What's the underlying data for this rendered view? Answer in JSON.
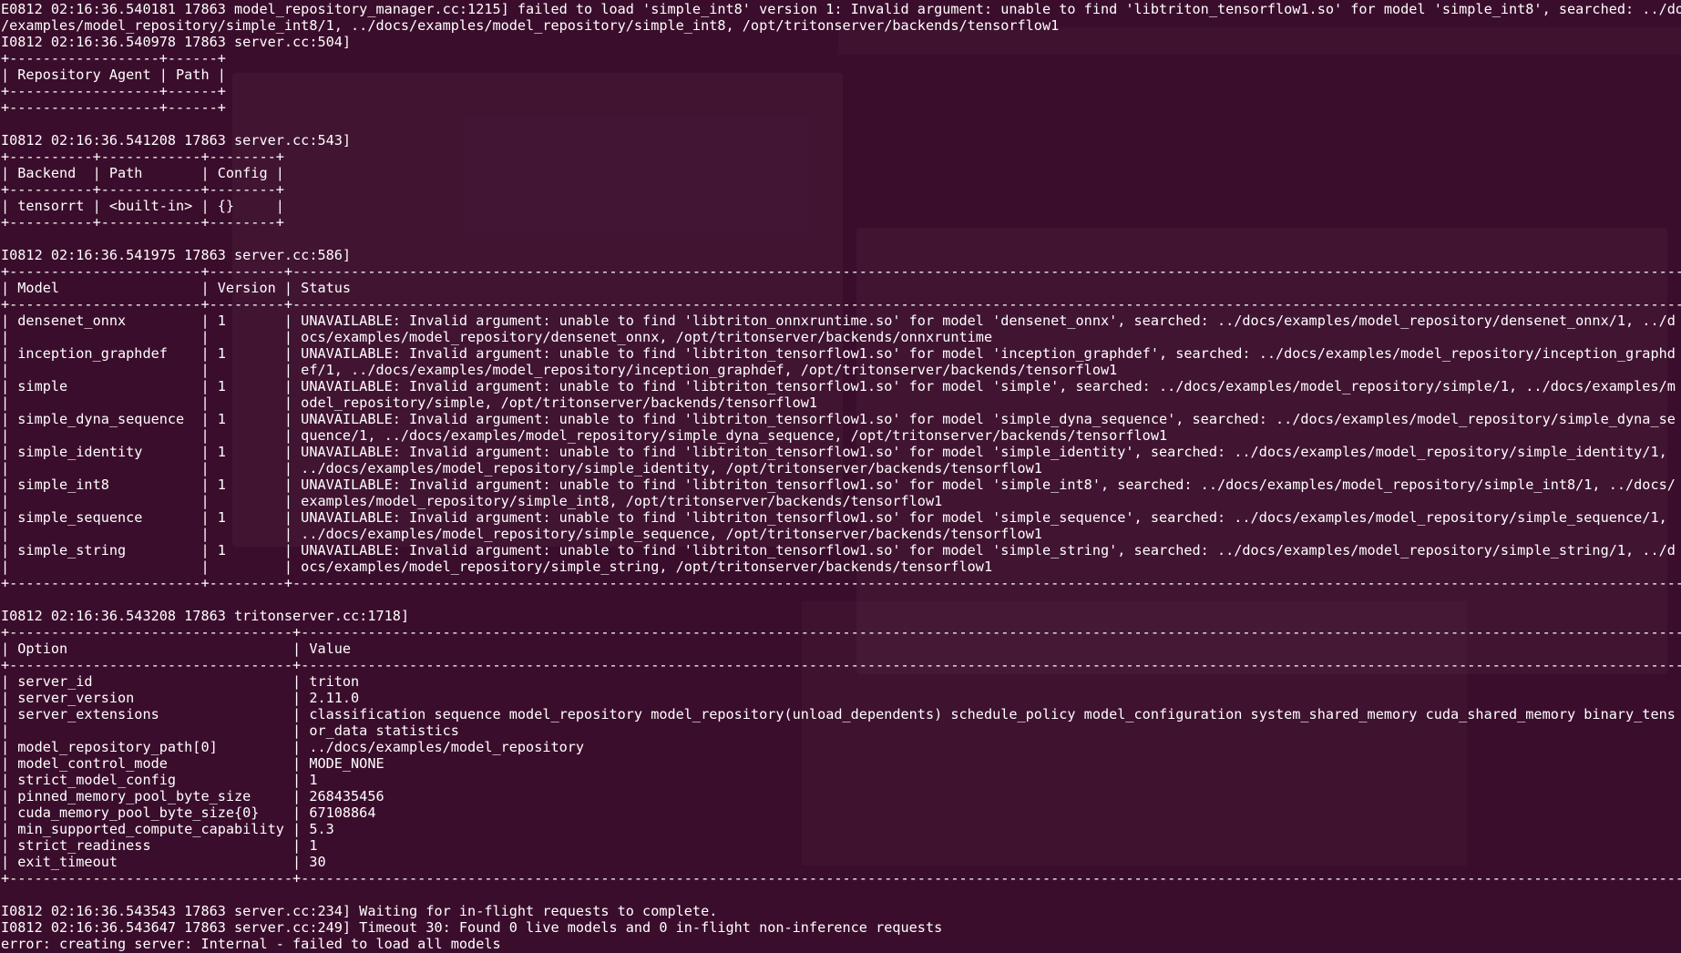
{
  "terminal": {
    "background": "#3b0d2c",
    "foreground": "#ffffff",
    "lines": [
      "E0812 02:16:36.540181 17863 model_repository_manager.cc:1215] failed to load 'simple_int8' version 1: Invalid argument: unable to find 'libtriton_tensorflow1.so' for model 'simple_int8', searched: ../docs",
      "/examples/model_repository/simple_int8/1, ../docs/examples/model_repository/simple_int8, /opt/tritonserver/backends/tensorflow1",
      "I0812 02:16:36.540978 17863 server.cc:504]",
      "+------------------+------+",
      "| Repository Agent | Path |",
      "+------------------+------+",
      "+------------------+------+",
      "",
      "I0812 02:16:36.541208 17863 server.cc:543]",
      "+----------+------------+--------+",
      "| Backend  | Path       | Config |",
      "+----------+------------+--------+",
      "| tensorrt | <built-in> | {}     |",
      "+----------+------------+--------+",
      "",
      "I0812 02:16:36.541975 17863 server.cc:586]",
      "+-----------------------+---------+------------------------------------------------------------------------------------------------------------------------------------------------------------------------------------------+",
      "| Model                 | Version | Status                                                                                                                                                                                   |",
      "+-----------------------+---------+------------------------------------------------------------------------------------------------------------------------------------------------------------------------------------------+",
      "| densenet_onnx         | 1       | UNAVAILABLE: Invalid argument: unable to find 'libtriton_onnxruntime.so' for model 'densenet_onnx', searched: ../docs/examples/model_repository/densenet_onnx/1, ../d |",
      "|                       |         | ocs/examples/model_repository/densenet_onnx, /opt/tritonserver/backends/onnxruntime                                                                                                      |",
      "| inception_graphdef    | 1       | UNAVAILABLE: Invalid argument: unable to find 'libtriton_tensorflow1.so' for model 'inception_graphdef', searched: ../docs/examples/model_repository/inception_graphd |",
      "|                       |         | ef/1, ../docs/examples/model_repository/inception_graphdef, /opt/tritonserver/backends/tensorflow1                                                                                        |",
      "| simple                | 1       | UNAVAILABLE: Invalid argument: unable to find 'libtriton_tensorflow1.so' for model 'simple', searched: ../docs/examples/model_repository/simple/1, ../docs/examples/m |",
      "|                       |         | odel_repository/simple, /opt/tritonserver/backends/tensorflow1                                                                                                                            |",
      "| simple_dyna_sequence  | 1       | UNAVAILABLE: Invalid argument: unable to find 'libtriton_tensorflow1.so' for model 'simple_dyna_sequence', searched: ../docs/examples/model_repository/simple_dyna_se |",
      "|                       |         | quence/1, ../docs/examples/model_repository/simple_dyna_sequence, /opt/tritonserver/backends/tensorflow1                                                                                 |",
      "| simple_identity       | 1       | UNAVAILABLE: Invalid argument: unable to find 'libtriton_tensorflow1.so' for model 'simple_identity', searched: ../docs/examples/model_repository/simple_identity/1,  |",
      "|                       |         | ../docs/examples/model_repository/simple_identity, /opt/tritonserver/backends/tensorflow1                                                                                                |",
      "| simple_int8           | 1       | UNAVAILABLE: Invalid argument: unable to find 'libtriton_tensorflow1.so' for model 'simple_int8', searched: ../docs/examples/model_repository/simple_int8/1, ../docs/ |",
      "|                       |         | examples/model_repository/simple_int8, /opt/tritonserver/backends/tensorflow1                                                                                                            |",
      "| simple_sequence       | 1       | UNAVAILABLE: Invalid argument: unable to find 'libtriton_tensorflow1.so' for model 'simple_sequence', searched: ../docs/examples/model_repository/simple_sequence/1,  |",
      "|                       |         | ../docs/examples/model_repository/simple_sequence, /opt/tritonserver/backends/tensorflow1                                                                                                |",
      "| simple_string         | 1       | UNAVAILABLE: Invalid argument: unable to find 'libtriton_tensorflow1.so' for model 'simple_string', searched: ../docs/examples/model_repository/simple_string/1, ../d |",
      "|                       |         | ocs/examples/model_repository/simple_string, /opt/tritonserver/backends/tensorflow1                                                                                                      |",
      "+-----------------------+---------+------------------------------------------------------------------------------------------------------------------------------------------------------------------------------------------+",
      "",
      "I0812 02:16:36.543208 17863 tritonserver.cc:1718]",
      "+----------------------------------+------------------------------------------------------------------------------------------------------------------------------------------------------------------------+",
      "| Option                           | Value                                                                                                                                                                  |",
      "+----------------------------------+------------------------------------------------------------------------------------------------------------------------------------------------------------------------+",
      "| server_id                        | triton                                                                                                                                                                 |",
      "| server_version                   | 2.11.0                                                                                                                                                                 |",
      "| server_extensions                | classification sequence model_repository model_repository(unload_dependents) schedule_policy model_configuration system_shared_memory cuda_shared_memory binary_tens |",
      "|                                  | or_data statistics                                                                                                                                                     |",
      "| model_repository_path[0]         | ../docs/examples/model_repository                                                                                                                                      |",
      "| model_control_mode               | MODE_NONE                                                                                                                                                              |",
      "| strict_model_config              | 1                                                                                                                                                                      |",
      "| pinned_memory_pool_byte_size     | 268435456                                                                                                                                                              |",
      "| cuda_memory_pool_byte_size{0}    | 67108864                                                                                                                                                               |",
      "| min_supported_compute_capability | 5.3                                                                                                                                                                    |",
      "| strict_readiness                 | 1                                                                                                                                                                      |",
      "| exit_timeout                     | 30                                                                                                                                                                     |",
      "+----------------------------------+------------------------------------------------------------------------------------------------------------------------------------------------------------------------+",
      "",
      "I0812 02:16:36.543543 17863 server.cc:234] Waiting for in-flight requests to complete.",
      "I0812 02:16:36.543647 17863 server.cc:249] Timeout 30: Found 0 live models and 0 in-flight non-inference requests",
      "error: creating server: Internal - failed to load all models"
    ]
  }
}
